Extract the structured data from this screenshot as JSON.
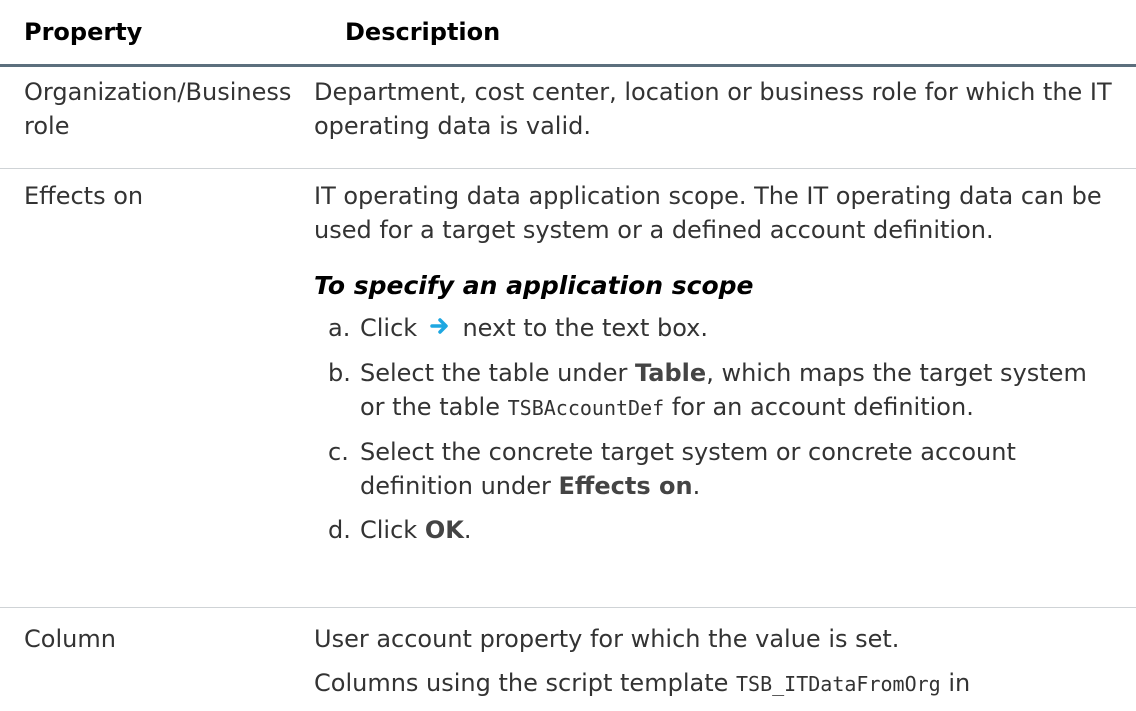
{
  "table": {
    "header": {
      "property": "Property",
      "description": "Description"
    },
    "rows": [
      {
        "property": "Organization/Business role",
        "description": "Department, cost center, location or business role for which the IT operating data is valid."
      },
      {
        "property": "Effects on",
        "description": "IT operating data application scope. The IT operating data can be used for a target system or a defined account definition.",
        "procedure_title": "To specify an application scope",
        "steps": {
          "a": {
            "label": "a.",
            "pre": "Click",
            "post": "next to the text box."
          },
          "b": {
            "label": "b.",
            "pre": "Select the table under",
            "bold": "Table",
            "mid": ", which maps the target system or the table",
            "code": "TSBAccountDef",
            "post": "for an account definition."
          },
          "c": {
            "label": "c.",
            "pre": "Select the concrete target system or concrete account definition under",
            "bold": "Effects on",
            "post": "."
          },
          "d": {
            "label": "d.",
            "pre": "Click",
            "bold": "OK",
            "post": "."
          }
        }
      },
      {
        "property": "Column",
        "description": "User account property for which the value is set.",
        "description2_pre": "Columns using the script template",
        "description2_code": "TSB_ITDataFromOrg",
        "description2_post": "in"
      }
    ]
  },
  "colors": {
    "arrow": "#1ea7e1",
    "header_rule": "#5c6f7d"
  }
}
